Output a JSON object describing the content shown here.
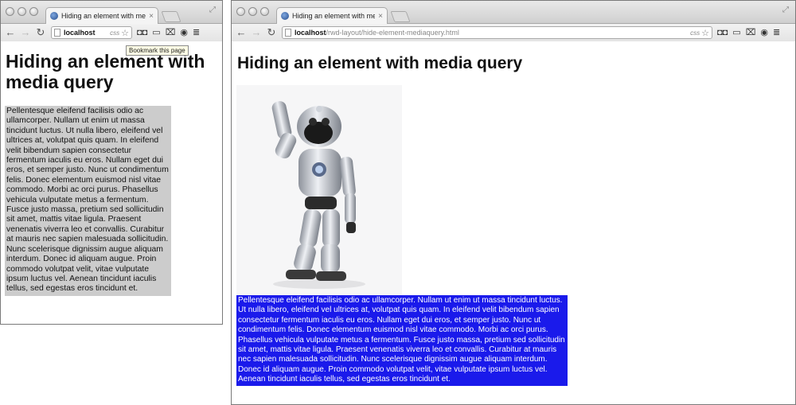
{
  "bookmark_tooltip": "Bookmark this page",
  "colors": {
    "small_paragraph_bg": "#cccccc",
    "large_paragraph_bg": "#1a1aeb",
    "large_paragraph_text": "#ffffff"
  },
  "small_window": {
    "tab_title": "Hiding an element with med",
    "url_host": "localhost",
    "url_path": "",
    "css_badge": "css",
    "page": {
      "heading": "Hiding an element with media query",
      "paragraph": "Pellentesque eleifend facilisis odio ac ullamcorper. Nullam ut enim ut massa tincidunt luctus. Ut nulla libero, eleifend vel ultrices at, volutpat quis quam. In eleifend velit bibendum sapien consectetur fermentum iaculis eu eros. Nullam eget dui eros, et semper justo. Nunc ut condimentum felis. Donec elementum euismod nisl vitae commodo. Morbi ac orci purus. Phasellus vehicula vulputate metus a fermentum. Fusce justo massa, pretium sed sollicitudin sit amet, mattis vitae ligula. Praesent venenatis viverra leo et convallis. Curabitur at mauris nec sapien malesuada sollicitudin. Nunc scelerisque dignissim augue aliquam interdum. Donec id aliquam augue. Proin commodo volutpat velit, vitae vulputate ipsum luctus vel. Aenean tincidunt iaculis tellus, sed egestas eros tincidunt et."
    }
  },
  "large_window": {
    "tab_title": "Hiding an element with med",
    "url_host": "localhost",
    "url_path": "/rwd-layout/hide-element-mediaquery.html",
    "css_badge": "css",
    "page": {
      "heading": "Hiding an element with media query",
      "paragraph": "Pellentesque eleifend facilisis odio ac ullamcorper. Nullam ut enim ut massa tincidunt luctus. Ut nulla libero, eleifend vel ultrices at, volutpat quis quam. In eleifend velit bibendum sapien consectetur fermentum iaculis eu eros. Nullam eget dui eros, et semper justo. Nunc ut condimentum felis. Donec elementum euismod nisl vitae commodo. Morbi ac orci purus. Phasellus vehicula vulputate metus a fermentum. Fusce justo massa, pretium sed sollicitudin sit amet, mattis vitae ligula. Praesent venenatis viverra leo et convallis. Curabitur at mauris nec sapien malesuada sollicitudin. Nunc scelerisque dignissim augue aliquam interdum. Donec id aliquam augue. Proin commodo volutpat velit, vitae vulputate ipsum luctus vel. Aenean tincidunt iaculis tellus, sed egestas eros tincidunt et."
    }
  }
}
